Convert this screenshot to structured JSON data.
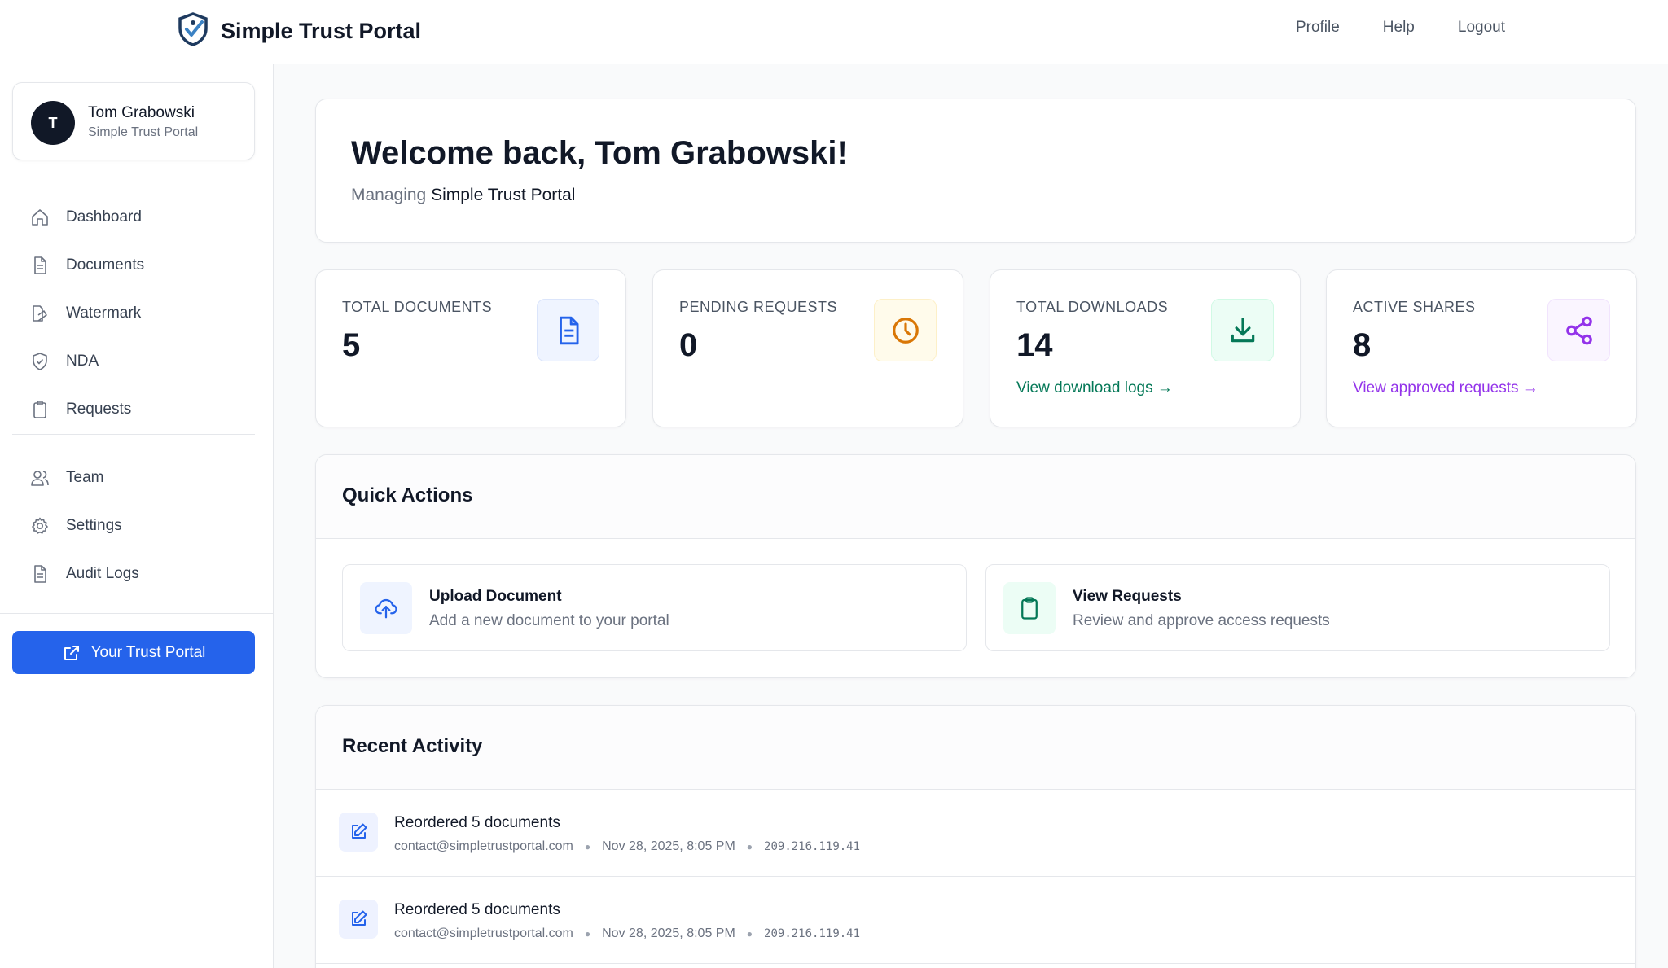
{
  "header": {
    "brand_name": "Simple Trust Portal",
    "nav": [
      "Profile",
      "Help",
      "Logout"
    ]
  },
  "sidebar": {
    "user": {
      "initial": "T",
      "name": "Tom Grabowski",
      "org": "Simple Trust Portal"
    },
    "primary_items": [
      {
        "label": "Dashboard",
        "icon": "home-icon"
      },
      {
        "label": "Documents",
        "icon": "document-icon"
      },
      {
        "label": "Watermark",
        "icon": "watermark-icon"
      },
      {
        "label": "NDA",
        "icon": "shield-icon"
      },
      {
        "label": "Requests",
        "icon": "clipboard-icon"
      }
    ],
    "secondary_items": [
      {
        "label": "Team",
        "icon": "users-icon"
      },
      {
        "label": "Settings",
        "icon": "gear-icon"
      },
      {
        "label": "Audit Logs",
        "icon": "document-icon"
      }
    ],
    "portal_button": "Your Trust Portal"
  },
  "welcome": {
    "title": "Welcome back, Tom Grabowski!",
    "managing_prefix": "Managing",
    "managing_org": "Simple Trust Portal"
  },
  "stats": [
    {
      "label": "TOTAL DOCUMENTS",
      "value": "5",
      "icon": "document-icon",
      "color": "#2563eb",
      "bg": "#eff4ff"
    },
    {
      "label": "PENDING REQUESTS",
      "value": "0",
      "icon": "clock-icon",
      "color": "#d97706",
      "bg": "#fffbeb"
    },
    {
      "label": "TOTAL DOWNLOADS",
      "value": "14",
      "icon": "download-icon",
      "color": "#047857",
      "bg": "#ecfdf5",
      "link": "View download logs →"
    },
    {
      "label": "ACTIVE SHARES",
      "value": "8",
      "icon": "share-icon",
      "color": "#9333ea",
      "bg": "#faf5ff",
      "link": "View approved requests →"
    }
  ],
  "quick_actions": {
    "title": "Quick Actions",
    "items": [
      {
        "title": "Upload Document",
        "desc": "Add a new document to your portal",
        "icon": "upload-cloud-icon"
      },
      {
        "title": "View Requests",
        "desc": "Review and approve access requests",
        "icon": "clipboard-icon"
      }
    ]
  },
  "recent_activity": {
    "title": "Recent Activity",
    "items": [
      {
        "title": "Reordered 5 documents",
        "email": "contact@simpletrustportal.com",
        "time": "Nov 28, 2025, 8:05 PM",
        "ip": "209.216.119.41"
      },
      {
        "title": "Reordered 5 documents",
        "email": "contact@simpletrustportal.com",
        "time": "Nov 28, 2025, 8:05 PM",
        "ip": "209.216.119.41"
      }
    ]
  }
}
